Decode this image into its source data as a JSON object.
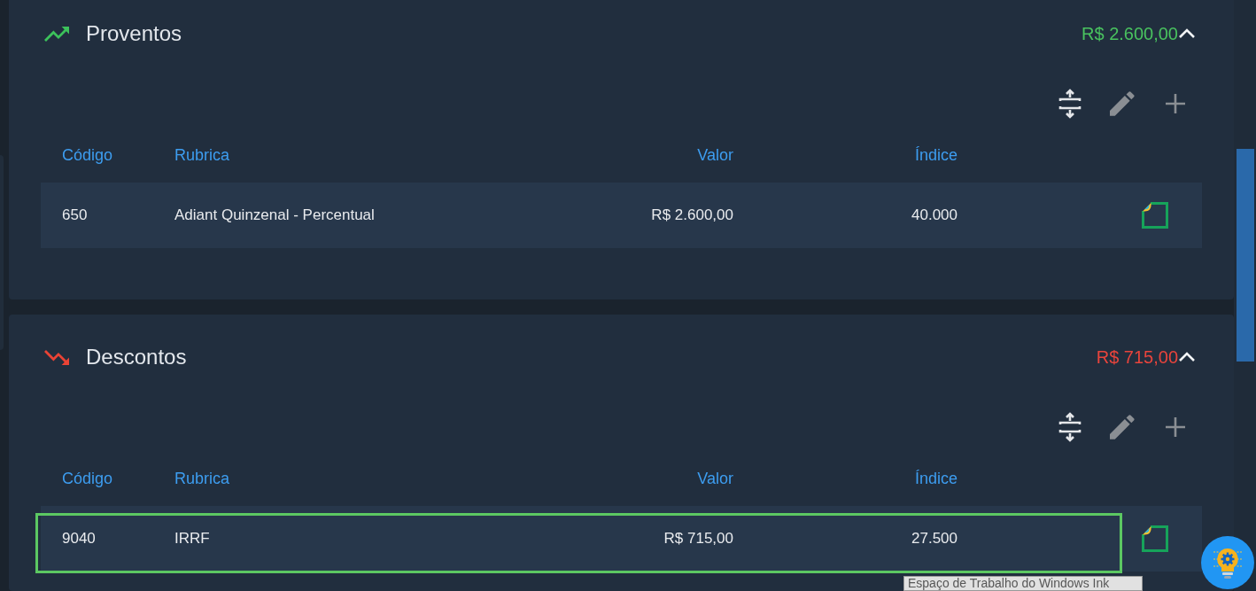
{
  "sections": [
    {
      "kind": "income",
      "title": "Proventos",
      "total": "R$ 2.600,00",
      "expanded": true,
      "columns": [
        "Código",
        "Rubrica",
        "Valor",
        "Índice"
      ],
      "rows": [
        {
          "code": "650",
          "rubrica": "Adiant Quinzenal - Percentual",
          "valor": "R$ 2.600,00",
          "indice": "40.000",
          "selected": false
        }
      ]
    },
    {
      "kind": "deduction",
      "title": "Descontos",
      "total": "R$ 715,00",
      "expanded": true,
      "columns": [
        "Código",
        "Rubrica",
        "Valor",
        "Índice"
      ],
      "rows": [
        {
          "code": "9040",
          "rubrica": "IRRF",
          "valor": "R$ 715,00",
          "indice": "27.500",
          "selected": true
        }
      ]
    }
  ],
  "tooltip": {
    "text": "Espaço de Trabalho do Windows Ink"
  }
}
